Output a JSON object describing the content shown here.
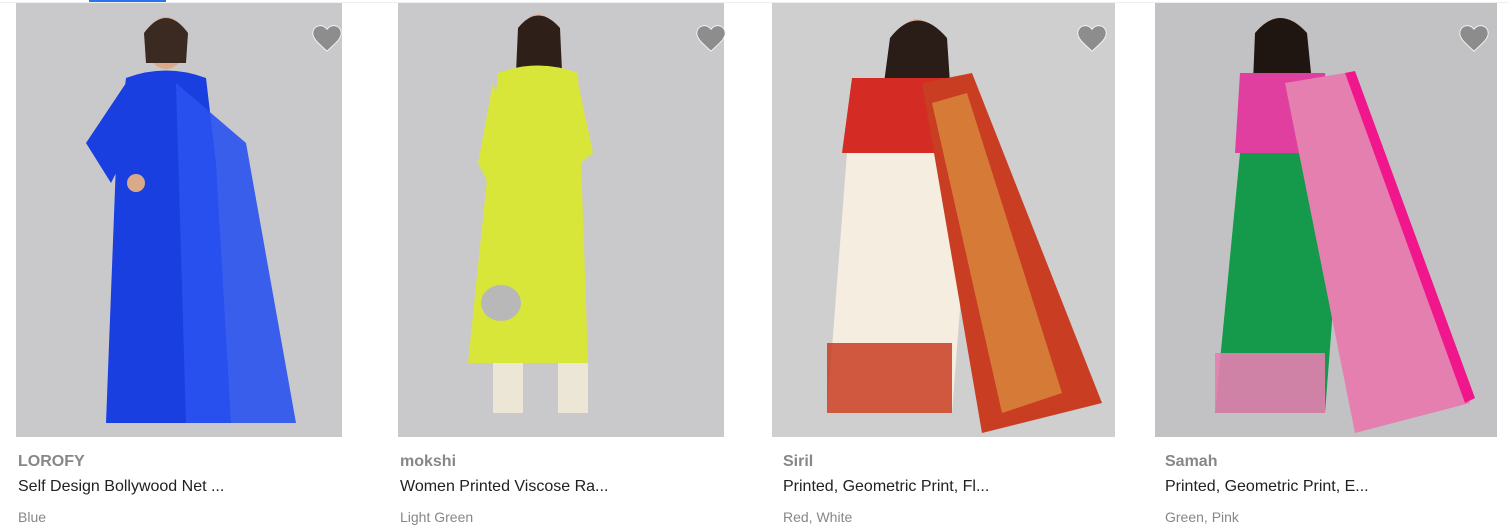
{
  "products": [
    {
      "brand": "LOROFY",
      "title": "Self Design Bollywood Net ...",
      "color": "Blue",
      "image_icon": "saree-blue-model-image",
      "dress_color": "#1a3fe0",
      "bg_color": "#c9c9cb"
    },
    {
      "brand": "mokshi",
      "title": "Women Printed Viscose Ra...",
      "color": "Light Green",
      "image_icon": "kurta-yellow-model-image",
      "dress_color": "#d8e63a",
      "bg_color": "#c9c9cb"
    },
    {
      "brand": "Siril",
      "title": "Printed, Geometric Print, Fl...",
      "color": "Red, White",
      "image_icon": "saree-red-white-model-image",
      "dress_color": "#d42b24",
      "bg_color": "#cfcfd0"
    },
    {
      "brand": "Samah",
      "title": "Printed, Geometric Print, E...",
      "color": "Green, Pink",
      "image_icon": "saree-green-pink-model-image",
      "dress_color": "#149a4a",
      "bg_color": "#c2c2c4"
    }
  ],
  "wishlist_icon": "heart-icon",
  "accent_color": "#2874f0"
}
